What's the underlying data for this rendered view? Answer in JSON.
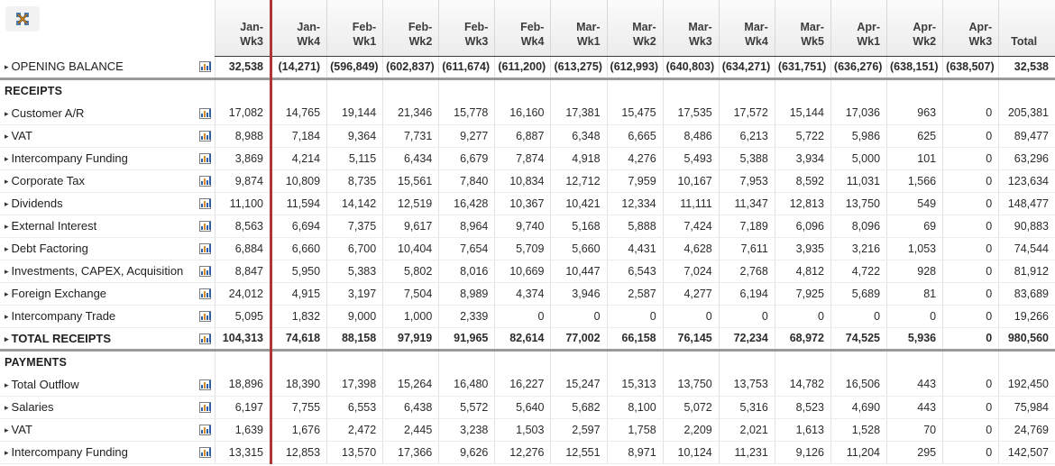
{
  "toolbar": {
    "expand_icon": "expand-arrows-icon"
  },
  "row_icon": "bar-chart-icon",
  "columns": [
    {
      "month": "Jan-",
      "week": "Wk3"
    },
    {
      "month": "Jan-",
      "week": "Wk4"
    },
    {
      "month": "Feb-",
      "week": "Wk1"
    },
    {
      "month": "Feb-",
      "week": "Wk2"
    },
    {
      "month": "Feb-",
      "week": "Wk3"
    },
    {
      "month": "Feb-",
      "week": "Wk4"
    },
    {
      "month": "Mar-",
      "week": "Wk1"
    },
    {
      "month": "Mar-",
      "week": "Wk2"
    },
    {
      "month": "Mar-",
      "week": "Wk3"
    },
    {
      "month": "Mar-",
      "week": "Wk4"
    },
    {
      "month": "Mar-",
      "week": "Wk5"
    },
    {
      "month": "Apr-",
      "week": "Wk1"
    },
    {
      "month": "Apr-",
      "week": "Wk2"
    },
    {
      "month": "Apr-",
      "week": "Wk3"
    }
  ],
  "total_column": "Total",
  "rows": [
    {
      "kind": "data",
      "label": "OPENING BALANCE",
      "values": [
        "32,538",
        "(14,271)",
        "(596,849)",
        "(602,837)",
        "(611,674)",
        "(611,200)",
        "(613,275)",
        "(612,993)",
        "(640,803)",
        "(634,271)",
        "(631,751)",
        "(636,276)",
        "(638,151)",
        "(638,507)"
      ],
      "total": "32,538"
    },
    {
      "kind": "section",
      "label": "RECEIPTS"
    },
    {
      "kind": "data",
      "label": "Customer A/R",
      "values": [
        "17,082",
        "14,765",
        "19,144",
        "21,346",
        "15,778",
        "16,160",
        "17,381",
        "15,475",
        "17,535",
        "17,572",
        "15,144",
        "17,036",
        "963",
        "0"
      ],
      "total": "205,381"
    },
    {
      "kind": "data",
      "label": "VAT",
      "values": [
        "8,988",
        "7,184",
        "9,364",
        "7,731",
        "9,277",
        "6,887",
        "6,348",
        "6,665",
        "8,486",
        "6,213",
        "5,722",
        "5,986",
        "625",
        "0"
      ],
      "total": "89,477"
    },
    {
      "kind": "data",
      "label": "Intercompany Funding",
      "values": [
        "3,869",
        "4,214",
        "5,115",
        "6,434",
        "6,679",
        "7,874",
        "4,918",
        "4,276",
        "5,493",
        "5,388",
        "3,934",
        "5,000",
        "101",
        "0"
      ],
      "total": "63,296"
    },
    {
      "kind": "data",
      "label": "Corporate Tax",
      "values": [
        "9,874",
        "10,809",
        "8,735",
        "15,561",
        "7,840",
        "10,834",
        "12,712",
        "7,959",
        "10,167",
        "7,953",
        "8,592",
        "11,031",
        "1,566",
        "0"
      ],
      "total": "123,634"
    },
    {
      "kind": "data",
      "label": "Dividends",
      "values": [
        "11,100",
        "11,594",
        "14,142",
        "12,519",
        "16,428",
        "10,367",
        "10,421",
        "12,334",
        "11,111",
        "11,347",
        "12,813",
        "13,750",
        "549",
        "0"
      ],
      "total": "148,477"
    },
    {
      "kind": "data",
      "label": "External Interest",
      "values": [
        "8,563",
        "6,694",
        "7,375",
        "9,617",
        "8,964",
        "9,740",
        "5,168",
        "5,888",
        "7,424",
        "7,189",
        "6,096",
        "8,096",
        "69",
        "0"
      ],
      "total": "90,883"
    },
    {
      "kind": "data",
      "label": "Debt Factoring",
      "values": [
        "6,884",
        "6,660",
        "6,700",
        "10,404",
        "7,654",
        "5,709",
        "5,660",
        "4,431",
        "4,628",
        "7,611",
        "3,935",
        "3,216",
        "1,053",
        "0"
      ],
      "total": "74,544"
    },
    {
      "kind": "data",
      "label": "Investments, CAPEX, Acquisition",
      "values": [
        "8,847",
        "5,950",
        "5,383",
        "5,802",
        "8,016",
        "10,669",
        "10,447",
        "6,543",
        "7,024",
        "2,768",
        "4,812",
        "4,722",
        "928",
        "0"
      ],
      "total": "81,912"
    },
    {
      "kind": "data",
      "label": "Foreign Exchange",
      "values": [
        "24,012",
        "4,915",
        "3,197",
        "7,504",
        "8,989",
        "4,374",
        "3,946",
        "2,587",
        "4,277",
        "6,194",
        "7,925",
        "5,689",
        "81",
        "0"
      ],
      "total": "83,689"
    },
    {
      "kind": "data",
      "label": "Intercompany Trade",
      "values": [
        "5,095",
        "1,832",
        "9,000",
        "1,000",
        "2,339",
        "0",
        "0",
        "0",
        "0",
        "0",
        "0",
        "0",
        "0",
        "0"
      ],
      "total": "19,266"
    },
    {
      "kind": "total",
      "label": "TOTAL RECEIPTS",
      "values": [
        "104,313",
        "74,618",
        "88,158",
        "97,919",
        "91,965",
        "82,614",
        "77,002",
        "66,158",
        "76,145",
        "72,234",
        "68,972",
        "74,525",
        "5,936",
        "0"
      ],
      "total": "980,560"
    },
    {
      "kind": "section",
      "label": "PAYMENTS"
    },
    {
      "kind": "data",
      "label": "Total Outflow",
      "values": [
        "18,896",
        "18,390",
        "17,398",
        "15,264",
        "16,480",
        "16,227",
        "15,247",
        "15,313",
        "13,750",
        "13,753",
        "14,782",
        "16,506",
        "443",
        "0"
      ],
      "total": "192,450"
    },
    {
      "kind": "data",
      "label": "Salaries",
      "values": [
        "6,197",
        "7,755",
        "6,553",
        "6,438",
        "5,572",
        "5,640",
        "5,682",
        "8,100",
        "5,072",
        "5,316",
        "8,523",
        "4,690",
        "443",
        "0"
      ],
      "total": "75,984"
    },
    {
      "kind": "data",
      "label": "VAT",
      "values": [
        "1,639",
        "1,676",
        "2,472",
        "2,445",
        "3,238",
        "1,503",
        "2,597",
        "1,758",
        "2,209",
        "2,021",
        "1,613",
        "1,528",
        "70",
        "0"
      ],
      "total": "24,769"
    },
    {
      "kind": "data",
      "label": "Intercompany Funding",
      "values": [
        "13,315",
        "12,853",
        "13,570",
        "17,366",
        "9,626",
        "12,276",
        "12,551",
        "8,971",
        "10,124",
        "11,231",
        "9,126",
        "11,204",
        "295",
        "0"
      ],
      "total": "142,507"
    }
  ],
  "colors": {
    "divider_red": "#b03535",
    "header_bg": "#ececec",
    "rule_grey": "#9a9a9a",
    "icon_blue": "#2f5fa8",
    "icon_orange": "#d98a28"
  }
}
